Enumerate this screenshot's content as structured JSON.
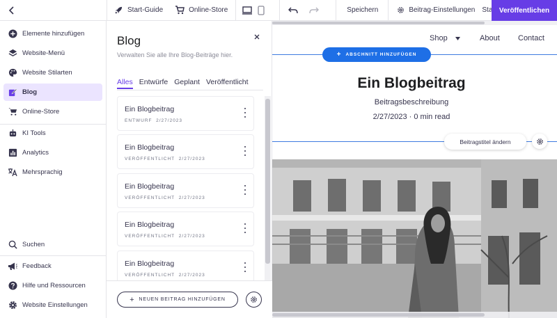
{
  "topbar": {
    "guide_label": "Start-Guide",
    "store_label": "Online-Store",
    "save_label": "Speichern",
    "post_settings_label": "Beitrag-Einstellungen",
    "status_label": "Status:E",
    "publish_label": "Veröffentlichen"
  },
  "sidebar": {
    "items": [
      {
        "label": "Elemente hinzufügen",
        "icon": "plus-circle-icon"
      },
      {
        "label": "Website-Menü",
        "icon": "layers-icon"
      },
      {
        "label": "Website Stilarten",
        "icon": "palette-icon"
      },
      {
        "label": "Blog",
        "icon": "edit-icon"
      },
      {
        "label": "Online-Store",
        "icon": "cart-icon"
      },
      {
        "label": "KI Tools",
        "icon": "robot-icon"
      },
      {
        "label": "Analytics",
        "icon": "bar-chart-icon"
      },
      {
        "label": "Mehrsprachig",
        "icon": "translate-icon"
      }
    ],
    "bottom_items": [
      {
        "label": "Suchen",
        "icon": "search-icon"
      },
      {
        "label": "Feedback",
        "icon": "megaphone-icon"
      },
      {
        "label": "Hilfe und Ressourcen",
        "icon": "help-icon"
      },
      {
        "label": "Website Einstellungen",
        "icon": "gear-icon"
      }
    ]
  },
  "panel": {
    "title": "Blog",
    "subtitle": "Verwalten Sie alle Ihre Blog-Beiträge hier.",
    "tabs": [
      "Alles",
      "Entwürfe",
      "Geplant",
      "Veröffentlicht"
    ],
    "posts": [
      {
        "title": "Ein Blogbeitrag",
        "status": "ENTWURF",
        "date": "2/27/2023"
      },
      {
        "title": "Ein Blogbeitrag",
        "status": "VERÖFFENTLICHT",
        "date": "2/27/2023"
      },
      {
        "title": "Ein Blogbeitrag",
        "status": "VERÖFFENTLICHT",
        "date": "2/27/2023"
      },
      {
        "title": "Ein Blogbeitrag",
        "status": "VERÖFFENTLICHT",
        "date": "2/27/2023"
      },
      {
        "title": "Ein Blogbeitrag",
        "status": "VERÖFFENTLICHT",
        "date": "2/27/2023"
      }
    ],
    "add_post_label": "NEUEN BEITRAG HINZUFÜGEN"
  },
  "canvas": {
    "nav": {
      "shop": "Shop",
      "about": "About",
      "contact": "Contact"
    },
    "add_section_label": "ABSCHNITT HINZUFÜGEN",
    "post_title": "Ein Blogbeitrag",
    "post_description": "Beitragsbeschreibung",
    "post_date": "2/27/2023 · 0 min read",
    "change_title_label": "Beitragstitel ändern"
  },
  "colors": {
    "accent": "#673de6",
    "active_bg": "#ebe4ff",
    "section_blue": "#1e6fe6"
  }
}
